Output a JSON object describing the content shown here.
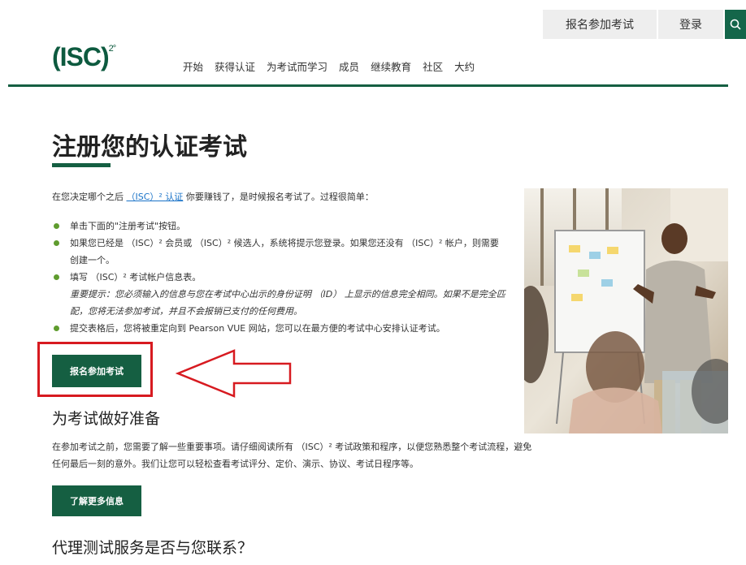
{
  "header": {
    "register_label": "报名参加考试",
    "login_label": "登录",
    "logo_text": "(ISC)",
    "logo_sup": "2°"
  },
  "nav": {
    "items": [
      "开始",
      "获得认证",
      "为考试而学习",
      "成员",
      "继续教育",
      "社区",
      "大约"
    ]
  },
  "main": {
    "title": "注册您的认证考试",
    "intro_before": "在您决定哪个之后",
    "intro_link": "（ISC）² 认证",
    "intro_after": "你要赚钱了，是时候报名考试了。过程很简单：",
    "steps": [
      "单击下面的\"注册考试\"按钮。",
      "如果您已经是 （ISC）² 会员或 （ISC）² 候选人，系统将提示您登录。如果您还没有 （ISC）² 帐户，则需要创建一个。",
      "填写 （ISC）² 考试帐户信息表。",
      "提交表格后，您将被重定向到 Pearson VUE 网站，您可以在最方便的考试中心安排认证考试。"
    ],
    "note": "重要提示：您必须输入的信息与您在考试中心出示的身份证明 （ID） 上显示的信息完全相同。如果不是完全匹配，您将无法参加考试，并且不会报销已支付的任何费用。",
    "register_button": "报名参加考试",
    "prepare_title": "为考试做好准备",
    "prepare_text": "在参加考试之前，您需要了解一些重要事项。请仔细阅读所有 （ISC）² 考试政策和程序，以便您熟悉整个考试流程，避免任何最后一刻的意外。我们让您可以轻松查看考试评分、定价、演示、协议、考试日程序等。",
    "learn_more_button": "了解更多信息",
    "proxy_title": "代理测试服务是否与您联系？"
  },
  "colors": {
    "brand_green": "#155f42",
    "bullet_green": "#5f9c2e",
    "highlight_red": "#d71a20",
    "link_blue": "#1a73c8"
  }
}
